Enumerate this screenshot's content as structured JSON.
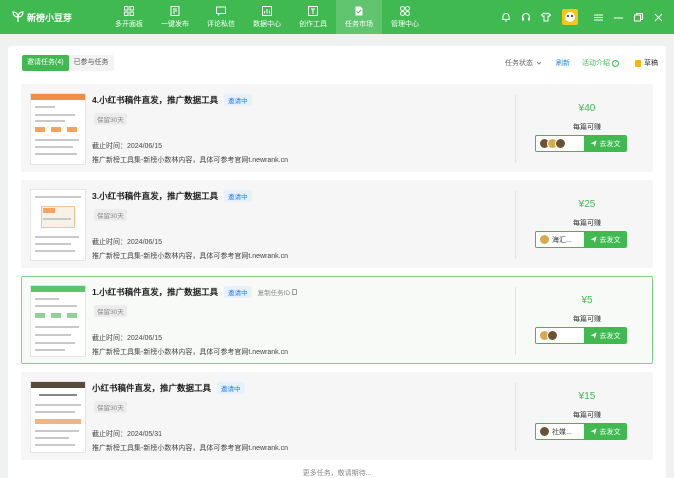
{
  "app": {
    "name": "新榜小豆芽",
    "brand_color": "#3fb950",
    "link_color": "#1e88e5"
  },
  "nav": [
    {
      "label": "多开面板",
      "icon": "grid-icon",
      "active": false
    },
    {
      "label": "一键发布",
      "icon": "publish-icon",
      "active": false
    },
    {
      "label": "评论私信",
      "icon": "message-icon",
      "active": false
    },
    {
      "label": "数据中心",
      "icon": "chart-icon",
      "active": false
    },
    {
      "label": "创作工具",
      "icon": "tools-icon",
      "active": false
    },
    {
      "label": "任务市场",
      "icon": "task-icon",
      "active": true
    },
    {
      "label": "管理中心",
      "icon": "apps-icon",
      "active": false
    }
  ],
  "tabs": {
    "invited": "邀请任务(4)",
    "joined": "已参与任务"
  },
  "toolbar": {
    "status_filter": "任务状态",
    "refresh": "刷新",
    "intro": "活动介绍",
    "drafts": "草稿"
  },
  "tasks": [
    {
      "title": "4.小红书稿件直发，推广数据工具",
      "status": "邀请中",
      "keep": "保留30天",
      "deadline": "截止时间：2024/06/15",
      "desc": "推广新榜工具集-新榜小数林内容，具体可参考官网t.newrank.cn",
      "reward": "¥40",
      "reward_label": "每篇可赚",
      "account": "",
      "post": "去发文",
      "copy_id": "",
      "selected": false
    },
    {
      "title": "3.小红书稿件直发，推广数据工具",
      "status": "邀请中",
      "keep": "保留30天",
      "deadline": "截止时间：2024/06/15",
      "desc": "推广新榜工具集-新榜小数林内容，具体可参考官网t.newrank.cn",
      "reward": "¥25",
      "reward_label": "每篇可赚",
      "account": "海汇...",
      "post": "去发文",
      "copy_id": "",
      "selected": false
    },
    {
      "title": "1.小红书稿件直发，推广数据工具",
      "status": "邀请中",
      "keep": "保留30天",
      "deadline": "截止时间：2024/06/15",
      "desc": "推广新榜工具集-新榜小数林内容，具体可参考官网t.newrank.cn",
      "reward": "¥5",
      "reward_label": "每篇可赚",
      "account": "",
      "post": "去发文",
      "copy_id": "复制任务ID",
      "selected": true
    },
    {
      "title": "小红书稿件直发，推广数据工具",
      "status": "邀请中",
      "keep": "保留30天",
      "deadline": "截止时间：2024/05/31",
      "desc": "推广新榜工具集-新榜小数林内容，具体可参考官网t.newrank.cn",
      "reward": "¥15",
      "reward_label": "每篇可赚",
      "account": "社媒...",
      "post": "去发文",
      "copy_id": "",
      "selected": false
    }
  ],
  "footer": {
    "more": "更多任务，敬请期待..."
  }
}
